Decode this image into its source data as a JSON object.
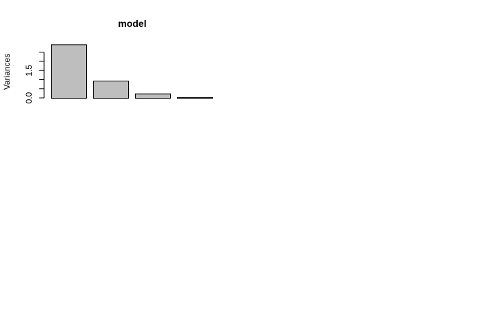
{
  "chart_data": {
    "type": "bar",
    "title": "model",
    "xlabel": "",
    "ylabel": "Variances",
    "categories": [
      "",
      "",
      "",
      ""
    ],
    "values": [
      2.93,
      0.94,
      0.24,
      0.04
    ],
    "ylim": [
      0,
      2.6
    ],
    "yticks": [
      0.0,
      0.5,
      1.0,
      1.5,
      2.0,
      2.5
    ],
    "ytick_labels": [
      "0.0",
      "",
      "",
      "1.5",
      "",
      ""
    ],
    "bar_fill": "#bebebe",
    "bar_stroke": "#000000",
    "grid": false,
    "legend": "none"
  }
}
